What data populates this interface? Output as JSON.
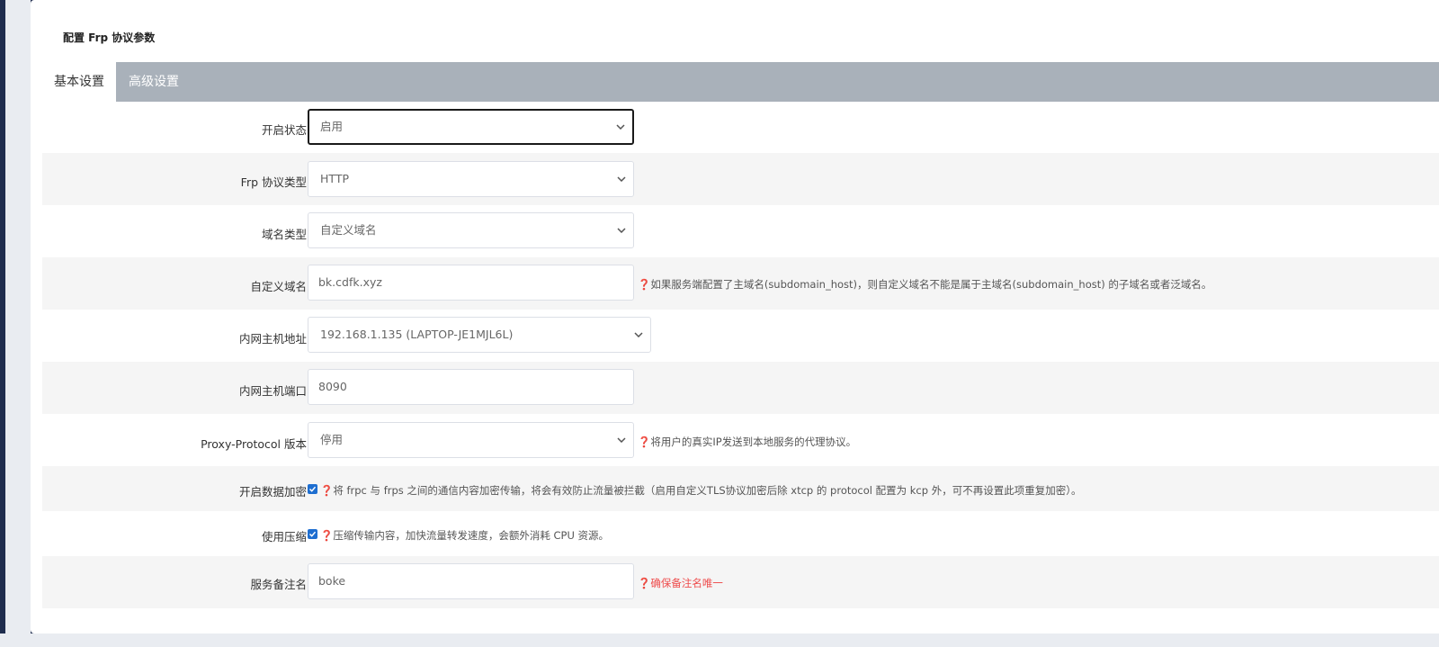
{
  "section_title": "配置 Frp 协议参数",
  "tabs": [
    {
      "label": "基本设置",
      "active": true
    },
    {
      "label": "高级设置",
      "active": false
    }
  ],
  "form": {
    "enable_status": {
      "label": "开启状态",
      "value": "启用"
    },
    "protocol_type": {
      "label": "Frp 协议类型",
      "value": "HTTP"
    },
    "domain_type": {
      "label": "域名类型",
      "value": "自定义域名"
    },
    "custom_domain": {
      "label": "自定义域名",
      "value": "bk.cdfk.xyz",
      "hint": "如果服务端配置了主域名(subdomain_host)，则自定义域名不能是属于主域名(subdomain_host) 的子域名或者泛域名。"
    },
    "local_host": {
      "label": "内网主机地址",
      "value": "192.168.1.135 (LAPTOP-JE1MJL6L)"
    },
    "local_port": {
      "label": "内网主机端口",
      "value": "8090"
    },
    "proxy_protocol": {
      "label": "Proxy-Protocol 版本",
      "value": "停用",
      "hint": "将用户的真实IP发送到本地服务的代理协议。"
    },
    "encryption": {
      "label": "开启数据加密",
      "checked": true,
      "hint": "将 frpc 与 frps 之间的通信内容加密传输，将会有效防止流量被拦截（启用自定义TLS协议加密后除 xtcp 的 protocol 配置为 kcp 外，可不再设置此项重复加密）。"
    },
    "compression": {
      "label": "使用压缩",
      "checked": true,
      "hint": "压缩传输内容，加快流量转发速度，会额外消耗 CPU 资源。"
    },
    "remark": {
      "label": "服务备注名",
      "value": "boke",
      "hint": "确保备注名唯一"
    }
  },
  "icons": {
    "question": "question-circle-icon",
    "chevron": "chevron-down-icon",
    "check": "check-icon"
  },
  "colors": {
    "tab_bar": "#a9b1ba",
    "checkbox": "#1e6ed0",
    "warning_text": "#ee4b4b",
    "sidebar": "#1f2d4e"
  }
}
